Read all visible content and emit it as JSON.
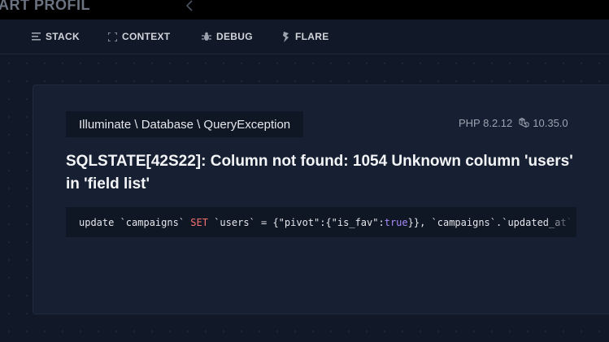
{
  "app": {
    "title": "ART PROFIL"
  },
  "nav": {
    "items": [
      {
        "label": "STACK",
        "icon": "stack-icon"
      },
      {
        "label": "CONTEXT",
        "icon": "context-icon"
      },
      {
        "label": "DEBUG",
        "icon": "bug-icon"
      },
      {
        "label": "FLARE",
        "icon": "flare-icon"
      }
    ]
  },
  "exception": {
    "class_name": "Illuminate \\ Database \\ QueryException",
    "php_version": "PHP 8.2.12",
    "laravel_version": "10.35.0",
    "message": "SQLSTATE[42S22]: Column not found: 1054 Unknown column 'users' in 'field list'",
    "sql": {
      "part1": "update `campaigns` ",
      "keyword": "SET",
      "part2": " `users` = {\"pivot\":{\"is_fav\":",
      "bool": "true",
      "part3": "}}, `campaigns`.`updated_at`"
    }
  },
  "colors": {
    "background": "#111827",
    "card": "#172033",
    "keyword": "#f87171",
    "boolean": "#a78bfa"
  }
}
